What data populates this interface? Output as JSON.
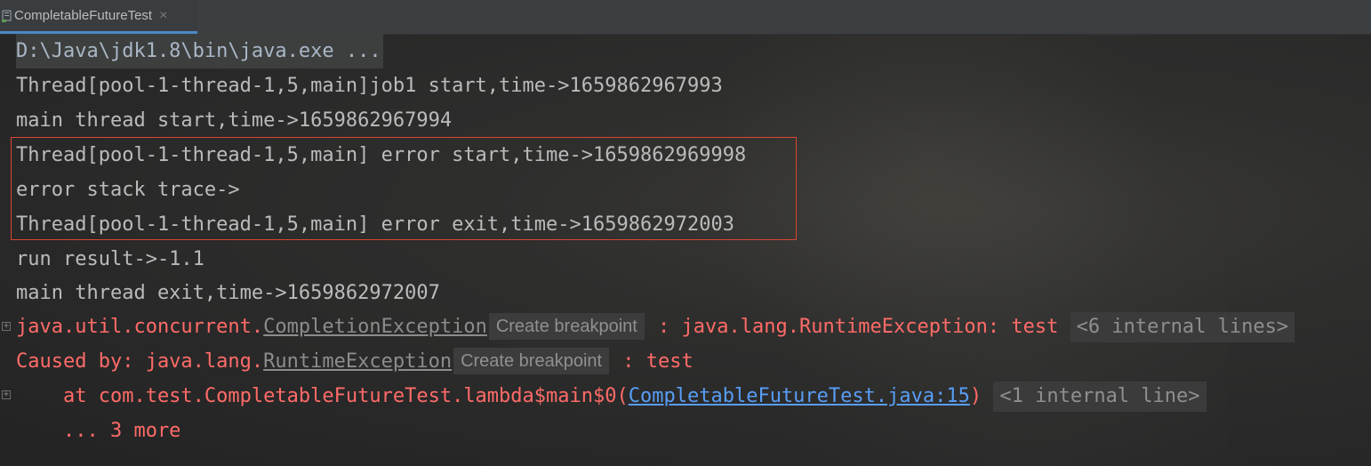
{
  "tab": {
    "title": "CompletableFutureTest",
    "close_symbol": "×",
    "icon": "console-icon"
  },
  "console": {
    "command": "D:\\Java\\jdk1.8\\bin\\java.exe ...",
    "lines": [
      "Thread[pool-1-thread-1,5,main]job1 start,time->1659862967993",
      "main thread start,time->1659862967994",
      "Thread[pool-1-thread-1,5,main] error start,time->1659862969998",
      "error stack trace->",
      "Thread[pool-1-thread-1,5,main] error exit,time->1659862972003",
      "run result->-1.1",
      "main thread exit,time->1659862972007"
    ],
    "exception": {
      "prefix": "java.util.concurrent.",
      "class_link": "CompletionException",
      "breakpoint_label": "Create breakpoint",
      "message": " : java.lang.RuntimeException: test ",
      "internal": "<6 internal lines>"
    },
    "caused_by": {
      "prefix": "Caused by: java.lang.",
      "class_link": "RuntimeException",
      "breakpoint_label": "Create breakpoint",
      "message": " : test"
    },
    "stack": {
      "at_prefix": "    at com.test.CompletableFutureTest.lambda$main$0(",
      "file_link": "CompletableFutureTest.java:15",
      "close_paren": ")",
      "internal": "<1 internal line>"
    },
    "more": "    ... 3 more"
  },
  "colors": {
    "error_text": "#ff6b68",
    "normal_text": "#bbbbbb",
    "link_blue": "#589df6",
    "highlight_border": "#d9472f"
  }
}
